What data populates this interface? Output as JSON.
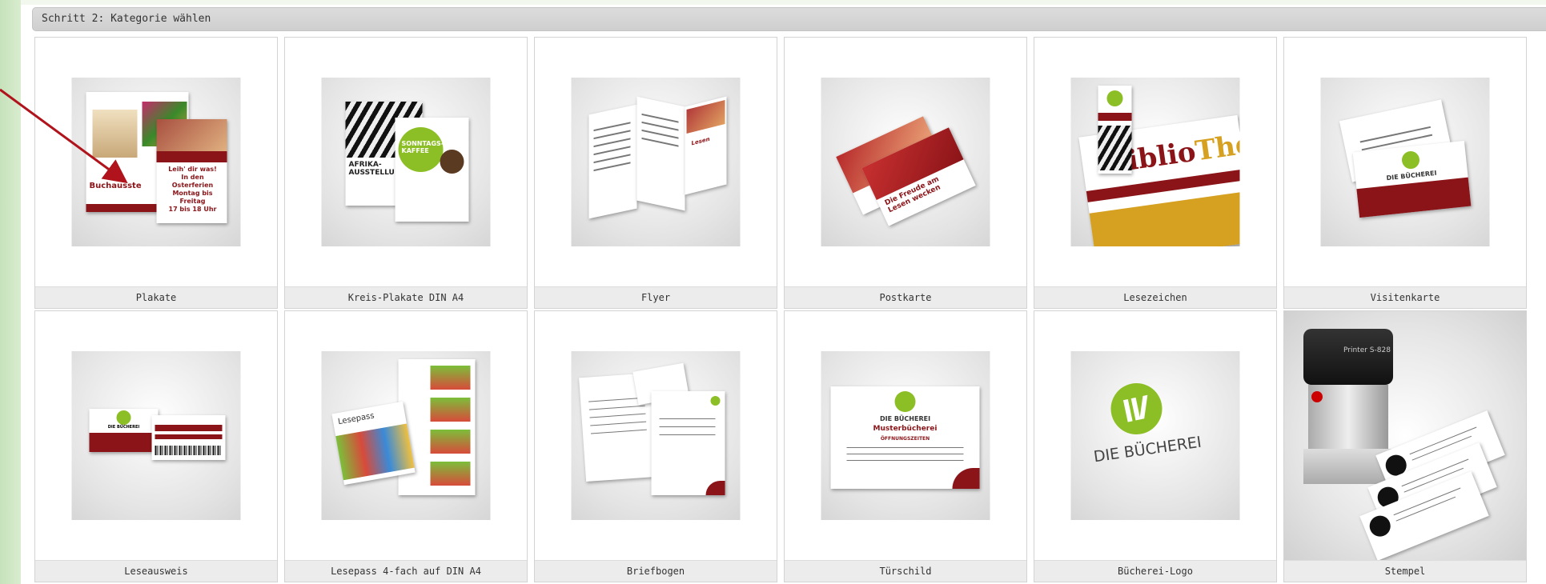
{
  "header": {
    "step_title": "Schritt 2:  Kategorie wählen"
  },
  "categories": [
    {
      "label": "Plakate",
      "poster_heading": "Leih' dir was!",
      "poster_sub": "In den Osterferien",
      "poster_sub2": "Montag bis Freitag",
      "poster_time": "17 bis 18 Uhr",
      "poster_left": "Buchausste"
    },
    {
      "label": "Kreis-Plakate DIN A4",
      "poster_a": "AFRIKA-AUSSTELLU",
      "poster_b": "SONNTAGS-KAFFEE"
    },
    {
      "label": "Flyer"
    },
    {
      "label": "Postkarte",
      "card_text": "Die Freude am Lesen wecken"
    },
    {
      "label": "Lesezeichen",
      "brand_a": "Biblio",
      "brand_b": "Thek"
    },
    {
      "label": "Visitenkarte",
      "brand": "DIE BÜCHEREI"
    },
    {
      "label": "Leseausweis",
      "brand": "DIE BÜCHEREI"
    },
    {
      "label": "Lesepass 4-fach auf DIN A4",
      "pass_text": "Lesepass"
    },
    {
      "label": "Briefbogen"
    },
    {
      "label": "Türschild",
      "brand": "DIE BÜCHEREI",
      "name": "Musterbücherei",
      "hours": "ÖFFNUNGSZEITEN"
    },
    {
      "label": "Bücherei-Logo",
      "brand": "DIE BÜCHEREI"
    },
    {
      "label": "Stempel",
      "stamp_brand": "Printer S-828"
    }
  ],
  "colors": {
    "maroon": "#8b1418",
    "green": "#8cbf26",
    "arrow": "#b0131b"
  }
}
